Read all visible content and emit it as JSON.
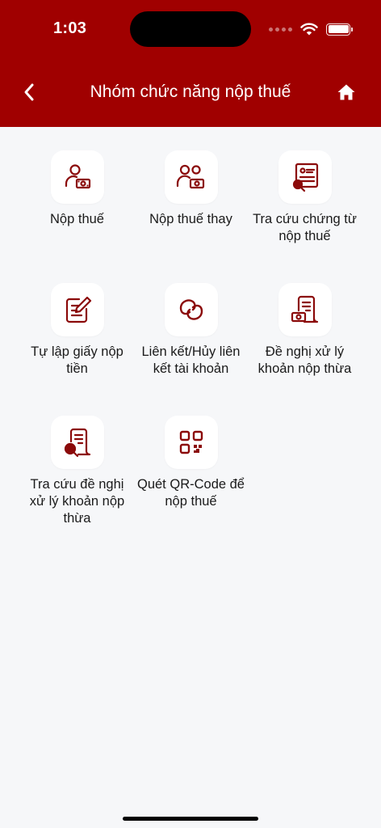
{
  "status_bar": {
    "time": "1:03"
  },
  "header": {
    "title": "Nhóm chức năng nộp thuế"
  },
  "colors": {
    "brand": "#a00000",
    "icon": "#8b0a0a",
    "background": "#f6f7f9"
  },
  "tiles": [
    {
      "label": "Nộp thuế",
      "icon": "person-money-icon"
    },
    {
      "label": "Nộp thuế thay",
      "icon": "people-money-icon"
    },
    {
      "label": "Tra cứu chứng từ nộp thuế",
      "icon": "document-search-icon"
    },
    {
      "label": "Tự lập giấy nộp tiền",
      "icon": "edit-form-icon"
    },
    {
      "label": "Liên kết/Hủy liên kết tài khoản",
      "icon": "link-icon"
    },
    {
      "label": "Đề nghị xử lý khoản nộp thừa",
      "icon": "receipt-money-icon"
    },
    {
      "label": "Tra cứu đề nghị xử lý khoản nộp thừa",
      "icon": "receipt-search-icon"
    },
    {
      "label": "Quét QR-Code để nộp thuế",
      "icon": "qr-code-icon"
    }
  ]
}
